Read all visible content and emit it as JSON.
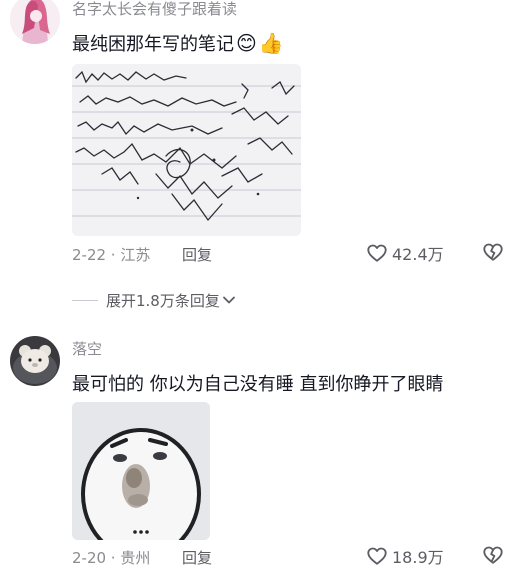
{
  "comments": [
    {
      "username": "名字太长会有傻子跟着读",
      "text": "最纯困那年写的笔记",
      "emojis": [
        "😊",
        "👍"
      ],
      "image": "sleepy handwritten notebook page",
      "date_location": "2-22 · 江苏",
      "reply_label": "回复",
      "likes": "42.4万"
    },
    {
      "username": "落空",
      "text": "最可怕的 你以为自己没有睡 直到你睁开了眼睛",
      "image": "blurry sleepy cartoon face meme",
      "date_location": "2-20 · 贵州",
      "reply_label": "回复",
      "likes": "18.9万"
    }
  ],
  "expand_replies": "展开1.8万条回复",
  "icons": {
    "like": "heart-outline-icon",
    "dislike": "broken-heart-icon",
    "expand": "chevron-down-icon"
  },
  "colors": {
    "text": "#161823",
    "secondary": "#8a8b91",
    "action": "#5c5d63"
  }
}
